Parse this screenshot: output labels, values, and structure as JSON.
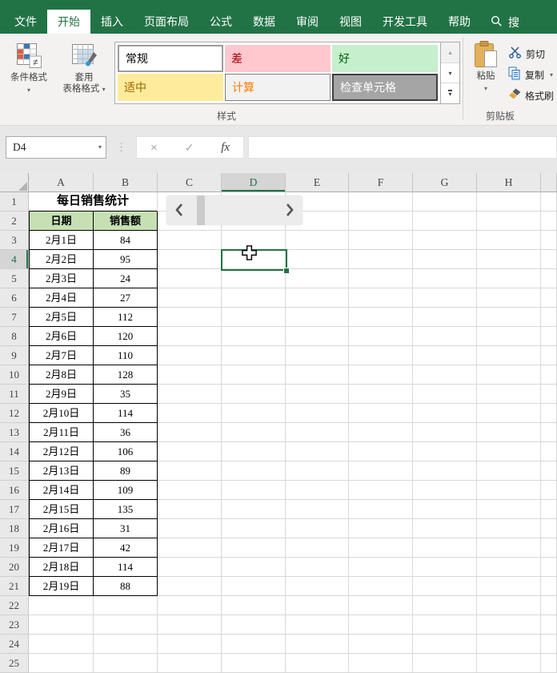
{
  "colors": {
    "excel_green": "#217346",
    "table_header_bg": "#C6E0B4",
    "selection_border": "#217346"
  },
  "icons": {
    "dropdown": "▾",
    "scroll_up": "▴",
    "scroll_down": "▾",
    "dots": "⋮",
    "cancel": "×",
    "enter": "✓",
    "insert_function": "fx",
    "not_equal": "≠"
  },
  "tab_bar": {
    "tabs": [
      {
        "label": "文件",
        "active": false
      },
      {
        "label": "开始",
        "active": true
      },
      {
        "label": "插入",
        "active": false
      },
      {
        "label": "页面布局",
        "active": false
      },
      {
        "label": "公式",
        "active": false
      },
      {
        "label": "数据",
        "active": false
      },
      {
        "label": "审阅",
        "active": false
      },
      {
        "label": "视图",
        "active": false
      },
      {
        "label": "开发工具",
        "active": false
      },
      {
        "label": "帮助",
        "active": false
      }
    ],
    "search_label": "搜"
  },
  "ribbon": {
    "styles_group": {
      "label": "样式",
      "conditional_format_label": "条件格式",
      "format_as_table_label_1": "套用",
      "format_as_table_label_2": "表格格式",
      "gallery": [
        {
          "label": "常规",
          "bg": "#FFFFFF",
          "fg": "#000000",
          "border": "#9C9C9C",
          "border_width": 2,
          "selected": true
        },
        {
          "label": "差",
          "bg": "#FFC7CE",
          "fg": "#9C0006"
        },
        {
          "label": "好",
          "bg": "#C6EFCE",
          "fg": "#006100"
        },
        {
          "label": "适中",
          "bg": "#FFEB9C",
          "fg": "#9C6500"
        },
        {
          "label": "计算",
          "bg": "#F2F2F2",
          "fg": "#FA7D00",
          "border": "#7F7F7F",
          "border_width": 1
        },
        {
          "label": "检查单元格",
          "bg": "#A5A5A5",
          "fg": "#FFFFFF",
          "border": "#3F3F3F",
          "border_width": 2
        }
      ]
    },
    "clipboard_group": {
      "label": "剪贴板",
      "paste_label": "粘贴",
      "cut_label": "剪切",
      "copy_label": "复制",
      "format_painter_label": "格式刷"
    }
  },
  "formula_bar": {
    "name_box_value": "D4",
    "formula_value": ""
  },
  "sheet": {
    "column_letters": [
      "A",
      "B",
      "C",
      "D",
      "E",
      "F",
      "G",
      "H"
    ],
    "visible_rows": 25,
    "selected_column": "D",
    "selected_row": 4,
    "active_cell": "D4",
    "title": "每日销售统计",
    "table_headers": [
      "日期",
      "销售额"
    ],
    "table_rows": [
      [
        "2月1日",
        84
      ],
      [
        "2月2日",
        95
      ],
      [
        "2月3日",
        24
      ],
      [
        "2月4日",
        27
      ],
      [
        "2月5日",
        112
      ],
      [
        "2月6日",
        120
      ],
      [
        "2月7日",
        110
      ],
      [
        "2月8日",
        128
      ],
      [
        "2月9日",
        35
      ],
      [
        "2月10日",
        114
      ],
      [
        "2月11日",
        36
      ],
      [
        "2月12日",
        106
      ],
      [
        "2月13日",
        89
      ],
      [
        "2月14日",
        109
      ],
      [
        "2月15日",
        135
      ],
      [
        "2月16日",
        31
      ],
      [
        "2月17日",
        42
      ],
      [
        "2月18日",
        114
      ],
      [
        "2月19日",
        88
      ]
    ]
  }
}
